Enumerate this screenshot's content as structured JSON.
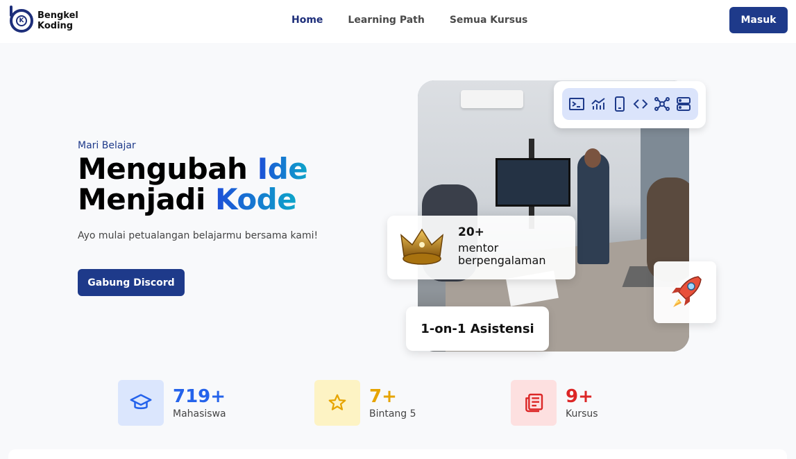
{
  "brand": {
    "line1": "Bengkel",
    "line2": "Koding",
    "mark_letter": "K"
  },
  "nav": {
    "items": [
      {
        "label": "Home",
        "active": true
      },
      {
        "label": "Learning Path",
        "active": false
      },
      {
        "label": "Semua Kursus",
        "active": false
      }
    ],
    "login_label": "Masuk"
  },
  "hero": {
    "eyebrow": "Mari Belajar",
    "headline": {
      "line1_plain": "Mengubah ",
      "line1_accent": "Ide",
      "line2_plain": "Menjadi ",
      "line2_accent": "Kode"
    },
    "subtext": "Ayo mulai petualangan belajarmu bersama kami!",
    "cta_label": "Gabung Discord"
  },
  "collage": {
    "tech_icons": [
      "terminal-icon",
      "chart-icon",
      "mobile-icon",
      "code-icon",
      "network-icon",
      "server-icon"
    ],
    "mentor_count": "20+",
    "mentor_line1": "mentor",
    "mentor_line2": "berpengalaman",
    "assist_label": "1-on-1 Asistensi"
  },
  "stats": [
    {
      "value": "719+",
      "label": "Mahasiswa",
      "icon": "graduation-cap-icon",
      "color": "#2563eb",
      "bg": "#dbe6fd"
    },
    {
      "value": "7+",
      "label": "Bintang 5",
      "icon": "star-icon",
      "color": "#e6a400",
      "bg": "#fdf3c4"
    },
    {
      "value": "9+",
      "label": "Kursus",
      "icon": "newspaper-icon",
      "color": "#dc2626",
      "bg": "#fde0e0"
    }
  ],
  "colors": {
    "primary": "#1e3a8a",
    "accent_start": "#1d4ed8",
    "accent_end": "#0ea5c9"
  }
}
